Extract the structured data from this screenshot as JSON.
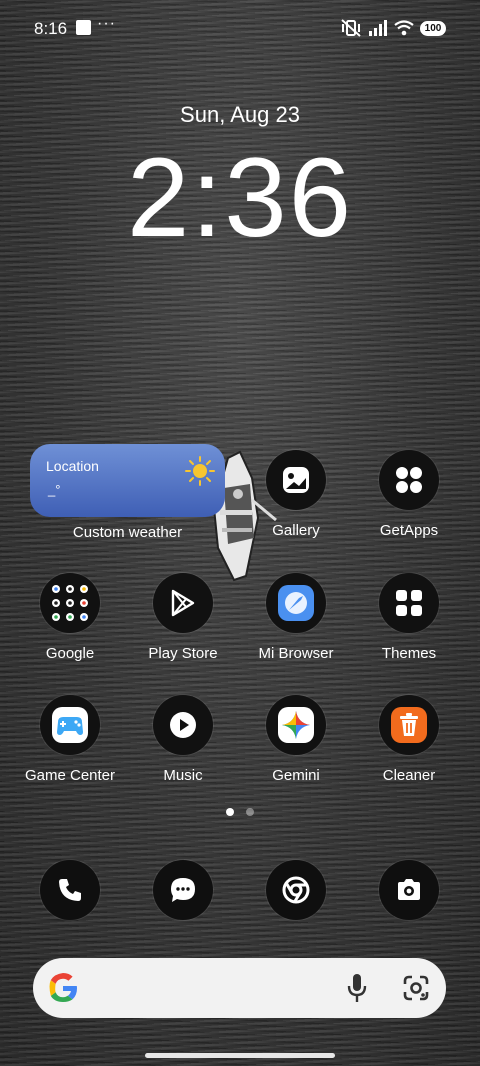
{
  "status_bar": {
    "time": "8:16",
    "overflow": "···",
    "battery": "100"
  },
  "lock": {
    "date": "Sun, Aug 23",
    "time": "2:36"
  },
  "weather": {
    "location": "Location",
    "value": "_°",
    "label": "Custom weather"
  },
  "apps": [
    {
      "label": "Gallery",
      "icon": "gallery-icon"
    },
    {
      "label": "GetApps",
      "icon": "getapps-icon"
    },
    {
      "label": "Google",
      "icon": "google-folder-icon"
    },
    {
      "label": "Play Store",
      "icon": "play-store-icon"
    },
    {
      "label": "Mi Browser",
      "icon": "mi-browser-icon"
    },
    {
      "label": "Themes",
      "icon": "themes-icon"
    },
    {
      "label": "Game Center",
      "icon": "game-center-icon"
    },
    {
      "label": "Music",
      "icon": "music-icon"
    },
    {
      "label": "Gemini",
      "icon": "gemini-icon"
    },
    {
      "label": "Cleaner",
      "icon": "cleaner-icon"
    }
  ],
  "dock": [
    {
      "icon": "phone-icon"
    },
    {
      "icon": "messages-icon"
    },
    {
      "icon": "chrome-icon"
    },
    {
      "icon": "camera-icon"
    }
  ],
  "pages": {
    "count": 2,
    "current": 1
  },
  "colors": {
    "weather_top": "#6f90d6",
    "weather_bottom": "#3f5fb5",
    "cleaner": "#f26b1d",
    "mi_browser": "#4a90f0"
  }
}
